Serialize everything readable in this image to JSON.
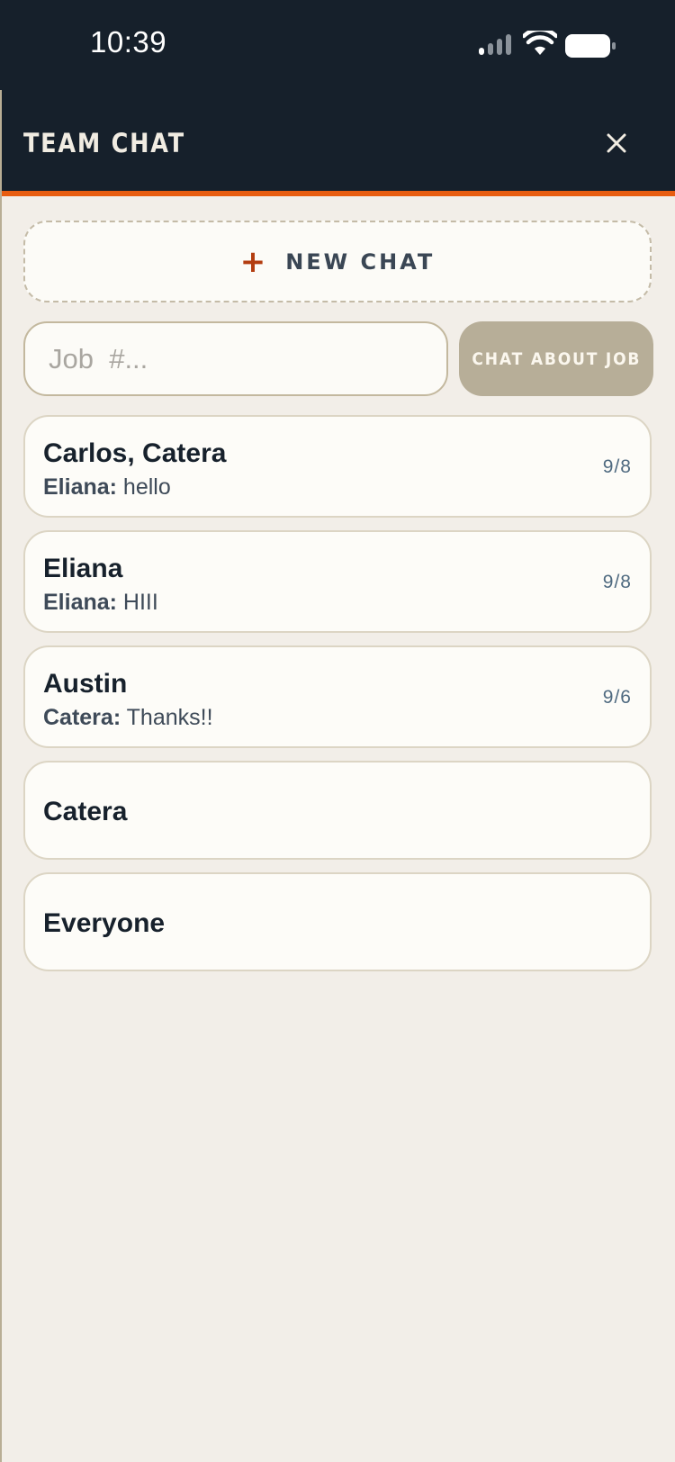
{
  "status_bar": {
    "time": "10:39",
    "icons": [
      "signal-icon",
      "wifi-icon",
      "battery-icon"
    ]
  },
  "header": {
    "title": "TEAM CHAT",
    "close_icon": "close-icon"
  },
  "new_chat": {
    "icon": "plus-icon",
    "icon_glyph": "+",
    "label": "NEW CHAT"
  },
  "job_search": {
    "placeholder": "Job  #...",
    "value": "",
    "button_label": "CHAT ABOUT JOB"
  },
  "chats": [
    {
      "name": "Carlos, Catera",
      "preview_sender": "Eliana:",
      "preview_text": " hello",
      "date": "9/8"
    },
    {
      "name": "Eliana",
      "preview_sender": "Eliana:",
      "preview_text": " HIII",
      "date": "9/8"
    },
    {
      "name": "Austin",
      "preview_sender": "Catera:",
      "preview_text": " Thanks!!",
      "date": "9/6"
    },
    {
      "name": "Catera"
    },
    {
      "name": "Everyone"
    }
  ],
  "colors": {
    "header_bg": "#16202b",
    "accent": "#e85d10",
    "plus": "#b33d10",
    "page_bg": "#f2eee8",
    "card_bg": "#fdfcf8",
    "button_bg": "#b7ae98"
  }
}
